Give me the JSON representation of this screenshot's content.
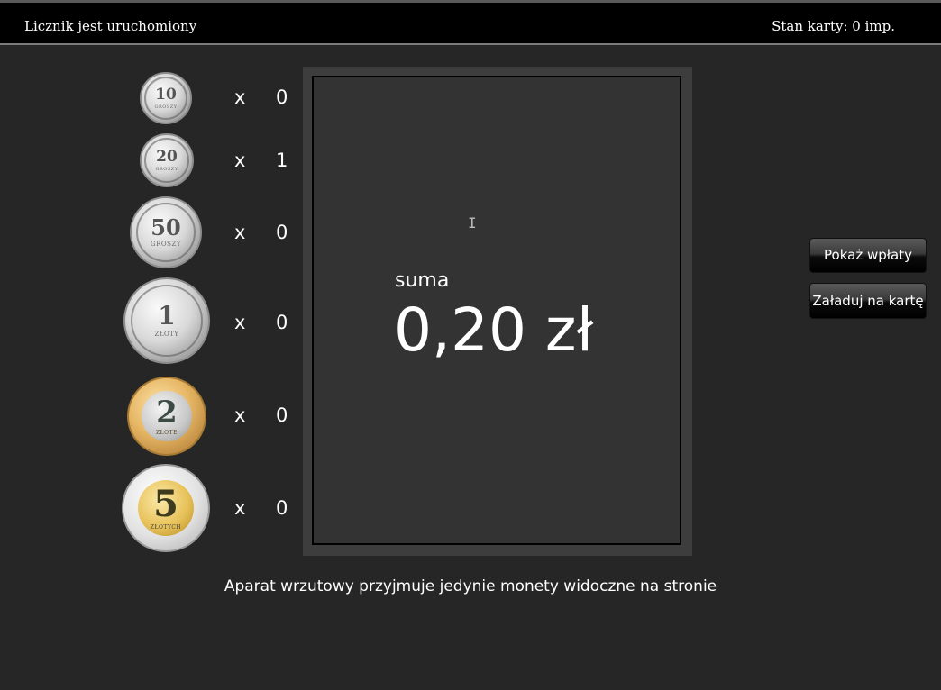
{
  "header": {
    "status_left": "Licznik jest uruchomiony",
    "status_right": "Stan karty: 0 imp."
  },
  "coins": [
    {
      "denomination": "10",
      "subtitle": "GROSZY",
      "metal": "silver",
      "multiplier": "x",
      "count": "0"
    },
    {
      "denomination": "20",
      "subtitle": "GROSZY",
      "metal": "silver",
      "multiplier": "x",
      "count": "1"
    },
    {
      "denomination": "50",
      "subtitle": "GROSZY",
      "metal": "silver",
      "multiplier": "x",
      "count": "0"
    },
    {
      "denomination": "1",
      "subtitle": "ZŁOTY",
      "metal": "silver",
      "multiplier": "x",
      "count": "0"
    },
    {
      "denomination": "2",
      "subtitle": "ZŁOTE",
      "metal": "bimetal-gold-outer",
      "multiplier": "x",
      "count": "0"
    },
    {
      "denomination": "5",
      "subtitle": "ZŁOTYCH",
      "metal": "bimetal-silver-outer",
      "multiplier": "x",
      "count": "0"
    }
  ],
  "display": {
    "label": "suma",
    "value": "0,20 zł"
  },
  "buttons": {
    "show_payments": "Pokaż wpłaty",
    "load_card": "Załaduj na kartę"
  },
  "footer": {
    "note": "Aparat wrzutowy przyjmuje jedynie monety widoczne na stronie"
  },
  "colors": {
    "background": "#262626",
    "display_frame": "#3d3d3d",
    "display_panel": "#333333",
    "text": "#ffffff"
  }
}
